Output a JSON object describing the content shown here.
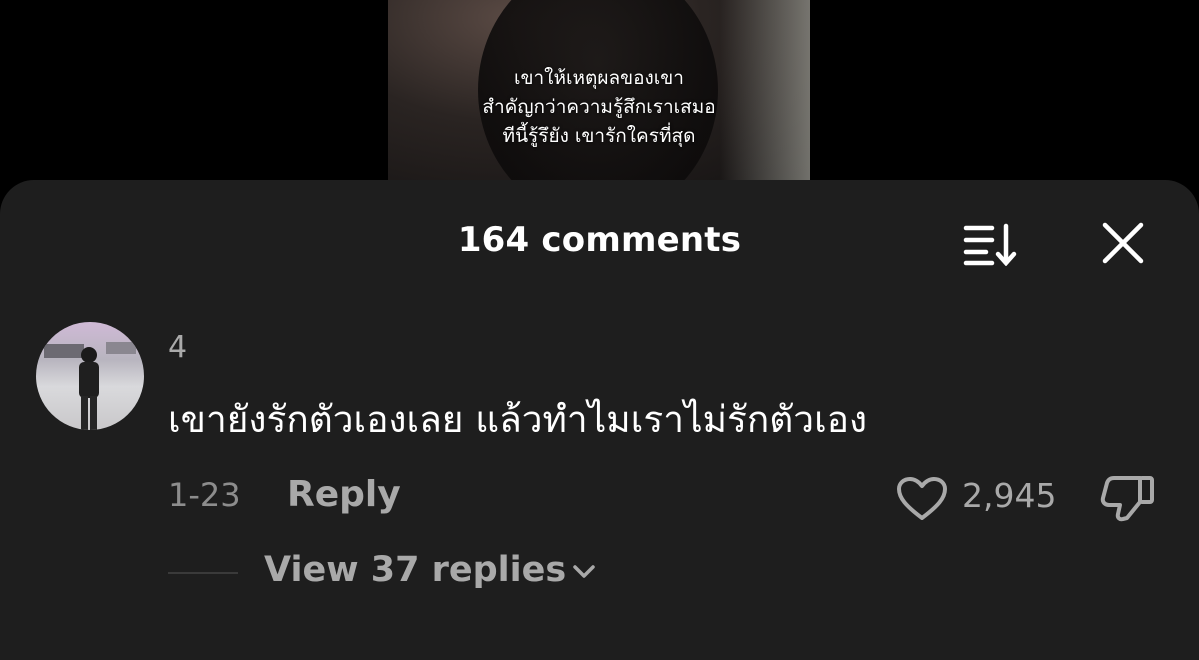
{
  "video": {
    "caption_lines": [
      "เขาให้เหตุผลของเขา",
      "สำคัญกว่าความรู้สึกเราเสมอ",
      "ทีนี้รู้รึยัง เขารักใครที่สุด"
    ]
  },
  "sheet": {
    "title": "164 comments",
    "sort_icon": "sort-descending-icon",
    "close_icon": "close-icon"
  },
  "comment": {
    "username": "4",
    "text": "เขายังรักตัวเองเลย แล้วทำไมเราไม่รักตัวเอง",
    "date": "1-23",
    "reply_label": "Reply",
    "likes": "2,945",
    "view_replies_label": "View 37 replies"
  },
  "colors": {
    "sheet_bg": "#1e1e1e",
    "page_bg": "#000000",
    "primary_text": "#ffffff",
    "secondary_text": "#a9a9a9"
  }
}
